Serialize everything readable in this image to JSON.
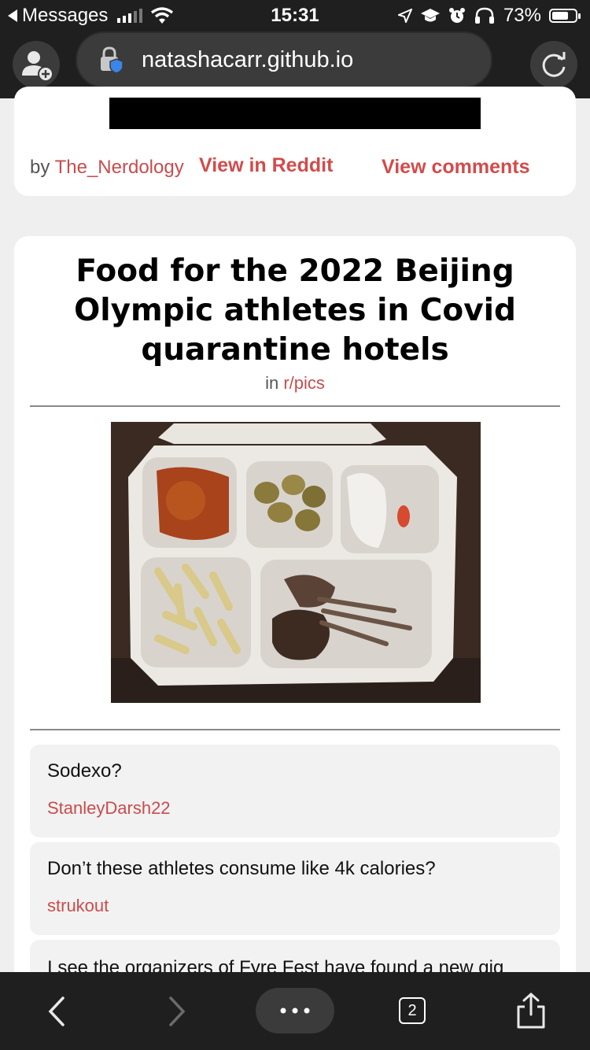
{
  "status_bar": {
    "back_app": "Messages",
    "time": "15:31",
    "battery_text": "73%",
    "battery_level": 0.73,
    "icons": [
      "signal-icon",
      "wifi-icon",
      "location-icon",
      "graduation-cap-icon",
      "alarm-icon",
      "headphones-icon",
      "battery-icon"
    ]
  },
  "browser": {
    "url": "natashacarr.github.io",
    "icons": [
      "add-profile-icon",
      "lock-shield-icon",
      "reload-icon"
    ]
  },
  "prev_post": {
    "by_prefix": "by",
    "author": "The_Nerdology",
    "view_reddit": "View in Reddit",
    "view_comments": "View comments"
  },
  "post": {
    "title": "Food for the 2022 Beijing Olympic athletes in Covid quarantine hotels",
    "in_prefix": "in",
    "subreddit": "r/pics"
  },
  "comments": [
    {
      "text": "Sodexo?",
      "user": "StanleyDarsh22"
    },
    {
      "text": "Don’t these athletes consume like 4k calories?",
      "user": "strukout"
    },
    {
      "text": "I see the organizers of Fyre Fest have found a new gig",
      "user": ""
    }
  ],
  "toolbar": {
    "tab_count": "2",
    "icons": [
      "back-arrow-icon",
      "forward-arrow-icon",
      "more-icon",
      "tabs-icon",
      "share-icon"
    ]
  },
  "colors": {
    "accent": "#d24b4b",
    "chrome": "#1f1f1f",
    "page_bg": "#efefef"
  }
}
